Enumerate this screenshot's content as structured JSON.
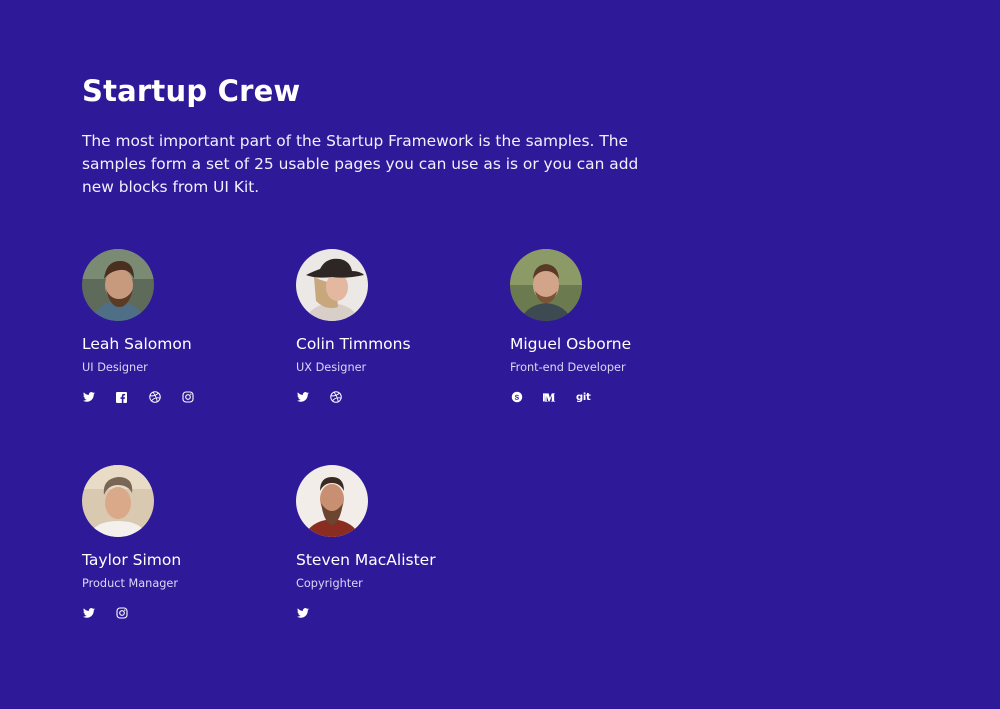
{
  "section": {
    "title": "Startup Crew",
    "intro": "The most important part of the Startup Framework is the samples. The samples form a set of 25 usable pages you can use as is or you can add new blocks from UI Kit."
  },
  "colors": {
    "background": "#2e1a99",
    "text": "#ffffff"
  },
  "members": [
    {
      "name": "Leah Salomon",
      "role": "UI Designer",
      "socials": [
        "twitter-icon",
        "facebook-icon",
        "dribbble-icon",
        "instagram-icon"
      ]
    },
    {
      "name": "Colin Timmons",
      "role": "UX Designer",
      "socials": [
        "twitter-icon",
        "dribbble-icon"
      ]
    },
    {
      "name": "Miguel Osborne",
      "role": "Front-end Developer",
      "socials": [
        "skype-icon",
        "medium-icon",
        "git-icon"
      ],
      "git_label": "git"
    },
    {
      "name": "Taylor Simon",
      "role": "Product Manager",
      "socials": [
        "twitter-icon",
        "instagram-icon"
      ]
    },
    {
      "name": "Steven MacAlister",
      "role": "Copyrighter",
      "socials": [
        "twitter-icon"
      ]
    }
  ]
}
